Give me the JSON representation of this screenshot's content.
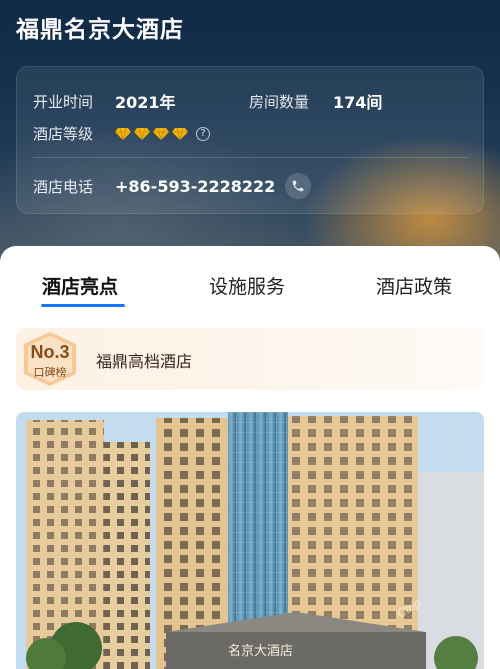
{
  "hotel": {
    "name": "福鼎名京大酒店"
  },
  "info": {
    "opened_label": "开业时间",
    "opened_value": "2021年",
    "rooms_label": "房间数量",
    "rooms_value": "174间",
    "grade_label": "酒店等级",
    "grade_diamonds": 4,
    "grade_icon": "diamond-icon",
    "phone_label": "酒店电话",
    "phone_value": "+86-593-2228222",
    "phone_icon": "phone-icon",
    "help_icon": "question-icon"
  },
  "tabs": [
    {
      "label": "酒店亮点",
      "active": true
    },
    {
      "label": "设施服务",
      "active": false
    },
    {
      "label": "酒店政策",
      "active": false
    }
  ],
  "rank": {
    "number": "No.3",
    "board": "口碑榜",
    "text": "福鼎高档酒店"
  },
  "photo": {
    "sign_text": "名京大酒店",
    "watermark": "Ctrip"
  },
  "colors": {
    "accent": "#1677ff",
    "diamond": "#f5b400",
    "rank_text": "#8a4a16"
  }
}
